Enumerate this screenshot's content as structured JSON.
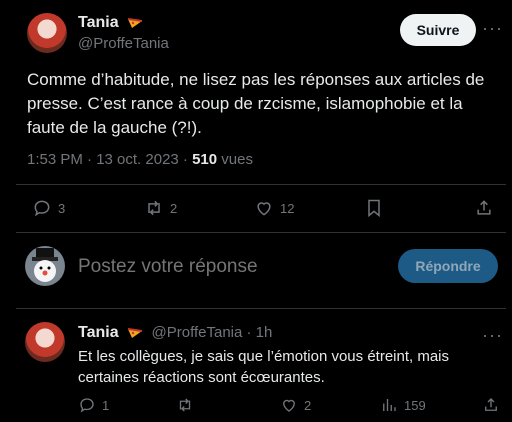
{
  "main_tweet": {
    "author_name": "Tania",
    "author_handle": "@ProffeTania",
    "follow_label": "Suivre",
    "more_label": "···",
    "text": "Comme d’habitude, ne lisez pas les réponses aux articles de presse. C’est rance à coup de rzcisme, islamophobie et la faute de la gauche (?!).",
    "time": "1:53 PM · 13 oct. 2023 · ",
    "views_count": "510",
    "views_label": " vues",
    "actions": {
      "replies": "3",
      "retweets": "2",
      "likes": "12"
    }
  },
  "composer": {
    "placeholder": "Postez votre réponse",
    "reply_button": "Répondre"
  },
  "reply_tweet": {
    "author_name": "Tania",
    "author_handle": "@ProffeTania · 1h",
    "more_label": "···",
    "text": "Et les collègues, je sais que l’émotion vous étreint, mais certaines réactions sont écœurantes.",
    "actions": {
      "replies": "1",
      "likes": "2",
      "views": "159"
    }
  },
  "colors": {
    "background": "#000000",
    "text": "#e7e9ea",
    "muted": "#71767b",
    "accent": "#1d9bf0",
    "divider": "#2f3336"
  }
}
